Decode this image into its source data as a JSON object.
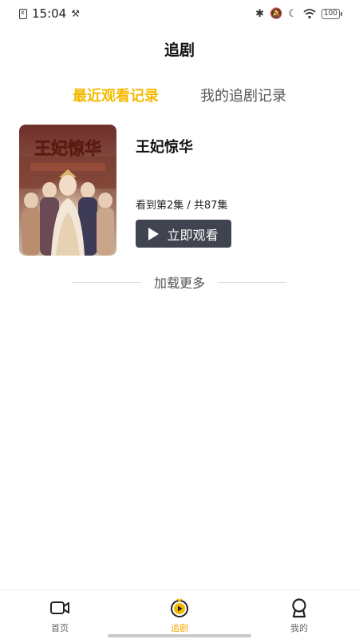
{
  "status_bar": {
    "time": "15:04",
    "battery": "100"
  },
  "header": {
    "title": "追剧"
  },
  "tabs": [
    {
      "label": "最近观看记录",
      "active": true
    },
    {
      "label": "我的追剧记录",
      "active": false
    }
  ],
  "card": {
    "poster_text": "王妃惊华",
    "title": "王妃惊华",
    "progress": "看到第2集 / 共87集",
    "watch_button": "立即观看"
  },
  "load_more": "加载更多",
  "bottom_nav": [
    {
      "label": "首页",
      "icon": "video-camera-icon",
      "active": false
    },
    {
      "label": "追剧",
      "icon": "play-circle-icon",
      "active": true
    },
    {
      "label": "我的",
      "icon": "user-badge-icon",
      "active": false
    }
  ],
  "colors": {
    "accent": "#f5b800",
    "button_bg": "#3f4450"
  }
}
